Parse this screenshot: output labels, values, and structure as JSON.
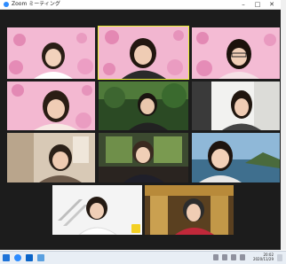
{
  "window": {
    "title": "Zoom ミーティング",
    "controls": {
      "minimize": "–",
      "maximize": "□",
      "close": "✕"
    }
  },
  "participants": [
    {
      "id": "p1",
      "background": "pink-flowers",
      "hair": "#2a1e16"
    },
    {
      "id": "p2",
      "background": "pink-flowers",
      "hair": "#231710",
      "active": true
    },
    {
      "id": "p3",
      "background": "pink-flowers",
      "hair": "#1c120c"
    },
    {
      "id": "p4",
      "background": "pink-flowers",
      "hair": "#2a1d14"
    },
    {
      "id": "p5",
      "background": "green-forest",
      "hair": "#1a1410"
    },
    {
      "id": "p6",
      "background": "white-room",
      "hair": "#20160f"
    },
    {
      "id": "p7",
      "background": "beige-room",
      "hair": "#2b2018"
    },
    {
      "id": "p8",
      "background": "green-window",
      "hair": "#3a2a20"
    },
    {
      "id": "p9",
      "background": "lake",
      "hair": "#1e140f"
    },
    {
      "id": "p10",
      "background": "white-stairs",
      "hair": "#241a13"
    },
    {
      "id": "p11",
      "background": "gold-temple",
      "hair": "#2c2c2c"
    }
  ],
  "taskbar": {
    "time": "20:02",
    "date": "2020/11/29",
    "colors": {
      "windows": "#1e73d8",
      "zoom": "#2d8cff",
      "outlook": "#0a64c8",
      "mail": "#5aa0e0"
    }
  },
  "colors": {
    "active_speaker": "#e8ee33",
    "unmute_badge": "#f3d024",
    "window_bg": "#1c1c1c"
  }
}
